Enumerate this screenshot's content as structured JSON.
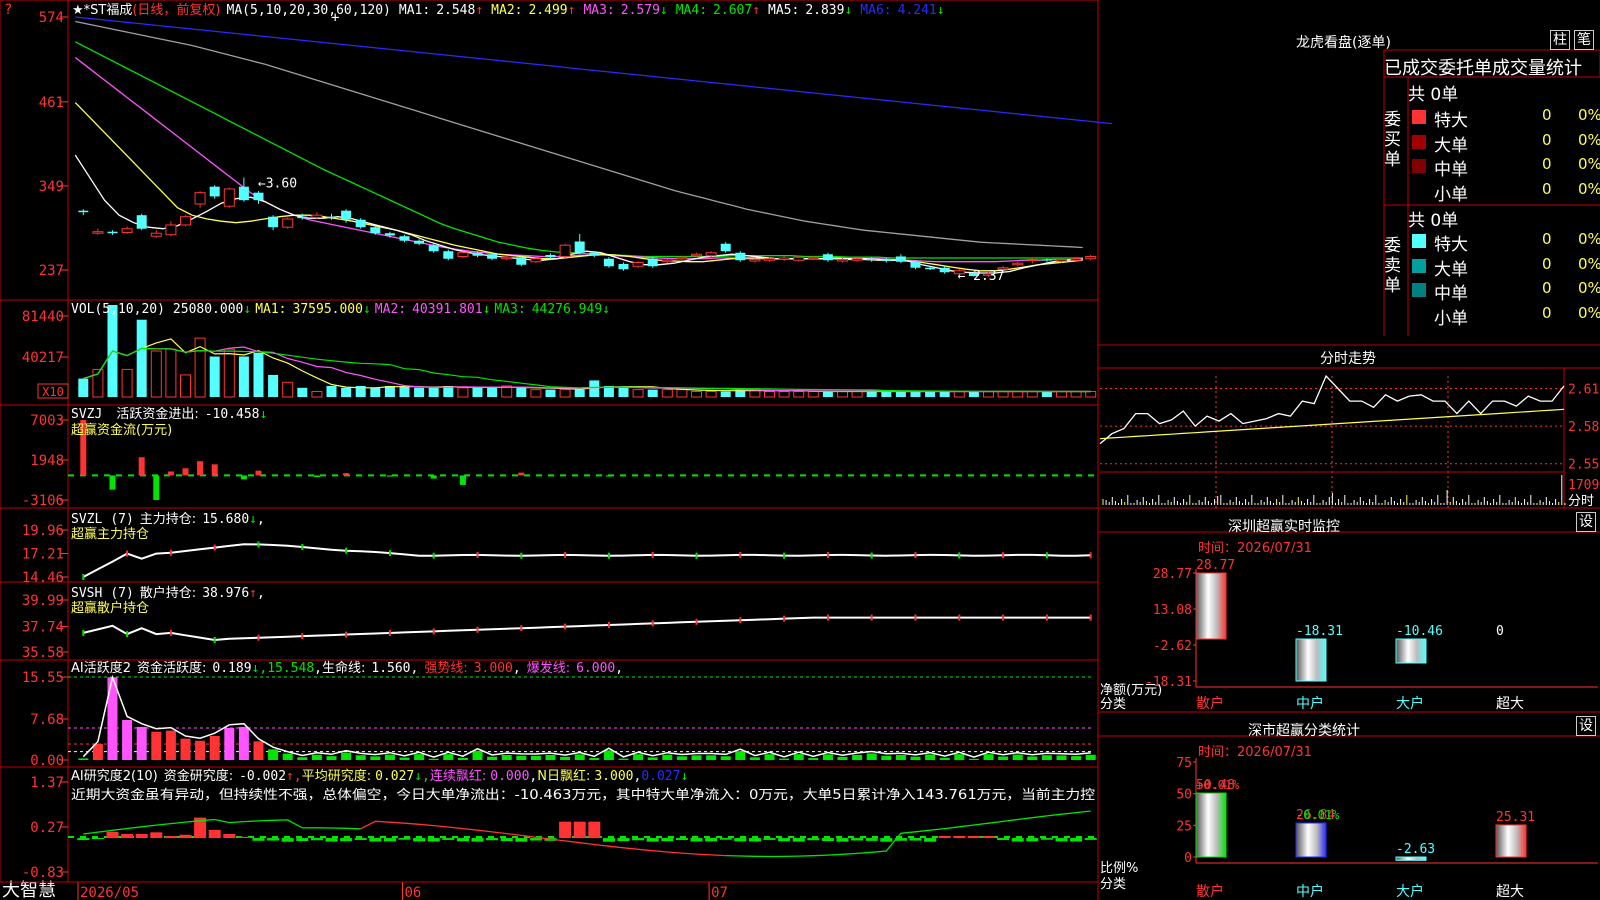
{
  "colors": {
    "up": "#ff3333",
    "down": "#54ffff",
    "frame": "#c00000",
    "yellow": "#ffff54",
    "magenta": "#ff54ff",
    "green": "#00e600",
    "blue": "#2a2aff",
    "white": "#ffffff",
    "grey": "#a0a0a0",
    "orange": "#ffa54a"
  },
  "header": {
    "title": "★*ST福成",
    "mode": "(日线，前复权)",
    "ma_title": "MA(5,10,20,30,60,120)",
    "ma": [
      {
        "label": "MA1:",
        "value": "2.548",
        "arrow": "↑"
      },
      {
        "label": "MA2:",
        "value": "2.499",
        "arrow": "↑"
      },
      {
        "label": "MA3:",
        "value": "2.579",
        "arrow": "↓"
      },
      {
        "label": "MA4:",
        "value": "2.607",
        "arrow": "↑"
      },
      {
        "label": "MA5:",
        "value": "2.839",
        "arrow": "↓"
      },
      {
        "label": "MA6:",
        "value": "4.241",
        "arrow": "↓"
      }
    ]
  },
  "chart_data": {
    "type": "candlestick",
    "candles": [
      [
        3.16,
        3.14,
        3.18,
        3.1
      ],
      [
        2.86,
        2.88,
        2.92,
        2.84
      ],
      [
        2.88,
        2.86,
        2.9,
        2.84
      ],
      [
        2.87,
        2.92,
        2.95,
        2.85
      ],
      [
        3.1,
        2.92,
        3.12,
        2.9
      ],
      [
        2.82,
        2.86,
        2.9,
        2.8
      ],
      [
        2.84,
        2.97,
        3.02,
        2.82
      ],
      [
        2.97,
        3.08,
        3.1,
        2.95
      ],
      [
        3.25,
        3.4,
        3.42,
        3.2
      ],
      [
        3.48,
        3.35,
        3.5,
        3.32
      ],
      [
        3.22,
        3.45,
        3.47,
        3.2
      ],
      [
        3.48,
        3.3,
        3.6,
        3.28
      ],
      [
        3.4,
        3.3,
        3.42,
        3.25
      ],
      [
        3.08,
        2.94,
        3.1,
        2.9
      ],
      [
        2.94,
        3.05,
        3.07,
        2.92
      ],
      [
        3.08,
        3.06,
        3.12,
        3.04
      ],
      [
        3.07,
        3.1,
        3.14,
        3.05
      ],
      [
        3.08,
        3.06,
        3.12,
        3.04
      ],
      [
        3.16,
        3.04,
        3.18,
        3.0
      ],
      [
        3.04,
        2.94,
        3.06,
        2.92
      ],
      [
        2.94,
        2.86,
        2.96,
        2.84
      ],
      [
        2.86,
        2.83,
        2.88,
        2.8
      ],
      [
        2.82,
        2.76,
        2.84,
        2.74
      ],
      [
        2.76,
        2.72,
        2.78,
        2.7
      ],
      [
        2.7,
        2.62,
        2.72,
        2.6
      ],
      [
        2.62,
        2.52,
        2.64,
        2.5
      ],
      [
        2.55,
        2.6,
        2.62,
        2.53
      ],
      [
        2.6,
        2.56,
        2.62,
        2.54
      ],
      [
        2.58,
        2.52,
        2.6,
        2.5
      ],
      [
        2.52,
        2.54,
        2.56,
        2.5
      ],
      [
        2.54,
        2.44,
        2.56,
        2.42
      ],
      [
        2.48,
        2.52,
        2.54,
        2.46
      ],
      [
        2.57,
        2.54,
        2.59,
        2.52
      ],
      [
        2.55,
        2.7,
        2.72,
        2.53
      ],
      [
        2.75,
        2.6,
        2.85,
        2.58
      ],
      [
        2.6,
        2.56,
        2.62,
        2.54
      ],
      [
        2.52,
        2.42,
        2.54,
        2.4
      ],
      [
        2.45,
        2.38,
        2.47,
        2.36
      ],
      [
        2.42,
        2.47,
        2.49,
        2.4
      ],
      [
        2.52,
        2.42,
        2.54,
        2.4
      ],
      [
        2.48,
        2.5,
        2.52,
        2.46
      ],
      [
        2.52,
        2.54,
        2.56,
        2.5
      ],
      [
        2.56,
        2.58,
        2.6,
        2.54
      ],
      [
        2.56,
        2.6,
        2.62,
        2.54
      ],
      [
        2.72,
        2.62,
        2.74,
        2.6
      ],
      [
        2.6,
        2.5,
        2.62,
        2.48
      ],
      [
        2.49,
        2.51,
        2.53,
        2.47
      ],
      [
        2.5,
        2.52,
        2.54,
        2.48
      ],
      [
        2.51,
        2.53,
        2.55,
        2.49
      ],
      [
        2.5,
        2.54,
        2.56,
        2.48
      ],
      [
        2.52,
        2.54,
        2.56,
        2.5
      ],
      [
        2.58,
        2.5,
        2.6,
        2.48
      ],
      [
        2.49,
        2.51,
        2.53,
        2.47
      ],
      [
        2.5,
        2.52,
        2.54,
        2.48
      ],
      [
        2.52,
        2.5,
        2.54,
        2.48
      ],
      [
        2.51,
        2.49,
        2.53,
        2.47
      ],
      [
        2.55,
        2.48,
        2.58,
        2.46
      ],
      [
        2.48,
        2.4,
        2.5,
        2.38
      ],
      [
        2.4,
        2.38,
        2.42,
        2.37
      ],
      [
        2.4,
        2.34,
        2.42,
        2.32
      ],
      [
        2.32,
        2.36,
        2.38,
        2.3
      ],
      [
        2.33,
        2.29,
        2.35,
        2.28
      ],
      [
        2.3,
        2.32,
        2.34,
        2.28
      ],
      [
        2.38,
        2.4,
        2.42,
        2.36
      ],
      [
        2.44,
        2.46,
        2.48,
        2.42
      ],
      [
        2.5,
        2.51,
        2.53,
        2.46
      ],
      [
        2.51,
        2.5,
        2.52,
        2.48
      ],
      [
        2.49,
        2.51,
        2.53,
        2.47
      ],
      [
        2.5,
        2.52,
        2.54,
        2.48
      ],
      [
        2.52,
        2.55,
        2.57,
        2.5
      ]
    ],
    "high_label": "3.60",
    "low_label": "2.37",
    "y_ticks": [
      "574",
      "461",
      "349",
      "237"
    ],
    "x_labels": [
      "2026/05",
      "06",
      "07"
    ],
    "ma_lines": {
      "ma6": [
        5.74,
        5.72,
        5.7,
        5.68,
        5.66,
        5.64,
        5.62,
        5.6,
        5.58,
        5.56,
        5.54,
        5.52,
        5.5,
        5.48,
        5.46,
        5.44,
        5.42,
        5.4,
        5.38,
        5.36,
        5.34,
        5.32,
        5.3,
        5.28,
        5.26,
        5.24,
        5.22,
        5.2,
        5.18,
        5.16,
        5.14,
        5.12,
        5.1,
        5.08,
        5.06,
        5.04,
        5.02,
        5.0,
        4.98,
        4.96,
        4.94,
        4.92,
        4.9,
        4.88,
        4.86,
        4.84,
        4.82,
        4.8,
        4.78,
        4.76,
        4.74,
        4.72,
        4.7,
        4.68,
        4.66,
        4.64,
        4.62,
        4.6,
        4.58,
        4.56,
        4.54,
        4.52,
        4.5,
        4.48,
        4.46,
        4.44,
        4.42,
        4.4,
        4.38,
        4.36,
        4.34,
        4.32
      ],
      "ma5": [
        5.68,
        5.64,
        5.6,
        5.56,
        5.52,
        5.48,
        5.44,
        5.4,
        5.36,
        5.31,
        5.26,
        5.21,
        5.16,
        5.11,
        5.05,
        4.99,
        4.93,
        4.87,
        4.81,
        4.75,
        4.69,
        4.63,
        4.57,
        4.51,
        4.45,
        4.39,
        4.33,
        4.27,
        4.21,
        4.15,
        4.09,
        4.03,
        3.97,
        3.91,
        3.85,
        3.79,
        3.73,
        3.67,
        3.61,
        3.55,
        3.49,
        3.43,
        3.38,
        3.33,
        3.28,
        3.23,
        3.18,
        3.14,
        3.1,
        3.06,
        3.02,
        2.99,
        2.96,
        2.93,
        2.9,
        2.88,
        2.86,
        2.84,
        2.82,
        2.8,
        2.78,
        2.76,
        2.74,
        2.73,
        2.72,
        2.71,
        2.7,
        2.69,
        2.68,
        2.67
      ],
      "ma4": [
        5.41,
        5.31,
        5.21,
        5.11,
        5.01,
        4.91,
        4.81,
        4.71,
        4.61,
        4.51,
        4.41,
        4.31,
        4.21,
        4.11,
        4.01,
        3.91,
        3.81,
        3.71,
        3.62,
        3.53,
        3.44,
        3.35,
        3.26,
        3.17,
        3.08,
        2.99,
        2.92,
        2.86,
        2.8,
        2.74,
        2.7,
        2.66,
        2.63,
        2.61,
        2.6,
        2.59,
        2.58,
        2.57,
        2.56,
        2.55,
        2.55,
        2.55,
        2.55,
        2.55,
        2.55,
        2.56,
        2.56,
        2.56,
        2.56,
        2.56,
        2.55,
        2.55,
        2.55,
        2.54,
        2.54,
        2.54,
        2.53,
        2.53,
        2.53,
        2.53,
        2.53,
        2.53,
        2.53,
        2.53,
        2.53,
        2.53,
        2.53,
        2.53,
        2.53,
        2.53
      ],
      "ma3": [
        5.2,
        5.05,
        4.9,
        4.75,
        4.6,
        4.45,
        4.3,
        4.15,
        4.0,
        3.85,
        3.7,
        3.55,
        3.4,
        3.28,
        3.18,
        3.1,
        3.04,
        3.0,
        2.96,
        2.92,
        2.88,
        2.84,
        2.8,
        2.76,
        2.72,
        2.68,
        2.65,
        2.62,
        2.6,
        2.58,
        2.57,
        2.56,
        2.55,
        2.55,
        2.56,
        2.57,
        2.57,
        2.56,
        2.55,
        2.54,
        2.53,
        2.52,
        2.52,
        2.52,
        2.53,
        2.53,
        2.52,
        2.52,
        2.52,
        2.52,
        2.52,
        2.52,
        2.52,
        2.52,
        2.52,
        2.52,
        2.51,
        2.5,
        2.49,
        2.48,
        2.48,
        2.48,
        2.48,
        2.48,
        2.49,
        2.5,
        2.5,
        2.51,
        2.51,
        2.52
      ],
      "ma2": [
        4.6,
        4.4,
        4.2,
        4.0,
        3.8,
        3.6,
        3.4,
        3.2,
        3.1,
        3.05,
        3.02,
        3.0,
        3.02,
        3.05,
        3.08,
        3.1,
        3.1,
        3.08,
        3.05,
        3.02,
        2.98,
        2.94,
        2.9,
        2.85,
        2.8,
        2.75,
        2.7,
        2.66,
        2.62,
        2.58,
        2.56,
        2.54,
        2.52,
        2.52,
        2.54,
        2.56,
        2.58,
        2.57,
        2.55,
        2.52,
        2.5,
        2.49,
        2.48,
        2.48,
        2.5,
        2.52,
        2.53,
        2.53,
        2.52,
        2.52,
        2.52,
        2.52,
        2.52,
        2.51,
        2.51,
        2.5,
        2.5,
        2.49,
        2.47,
        2.44,
        2.41,
        2.38,
        2.36,
        2.36,
        2.38,
        2.41,
        2.44,
        2.46,
        2.48,
        2.5
      ],
      "ma1": [
        3.9,
        3.6,
        3.3,
        3.1,
        3.0,
        2.94,
        2.92,
        2.96,
        3.05,
        3.15,
        3.26,
        3.32,
        3.34,
        3.28,
        3.18,
        3.1,
        3.06,
        3.06,
        3.08,
        3.05,
        3.0,
        2.95,
        2.9,
        2.84,
        2.76,
        2.7,
        2.64,
        2.6,
        2.57,
        2.55,
        2.53,
        2.51,
        2.5,
        2.52,
        2.58,
        2.62,
        2.6,
        2.54,
        2.48,
        2.44,
        2.44,
        2.46,
        2.5,
        2.54,
        2.56,
        2.58,
        2.56,
        2.54,
        2.52,
        2.52,
        2.52,
        2.52,
        2.53,
        2.52,
        2.52,
        2.51,
        2.5,
        2.49,
        2.44,
        2.4,
        2.36,
        2.34,
        2.33,
        2.33,
        2.35,
        2.4,
        2.44,
        2.48,
        2.5,
        2.52
      ]
    },
    "vol": {
      "title": "VOL(5,10,20)",
      "value": "25080.000",
      "arrow": "↓",
      "ma": [
        {
          "label": "MA1:",
          "value": "37595.000",
          "arrow": "↓"
        },
        {
          "label": "MA2:",
          "value": "40391.801",
          "arrow": "↓"
        },
        {
          "label": "MA3:",
          "value": "44276.949",
          "arrow": "↓"
        }
      ],
      "y_ticks": [
        "81440",
        "40217"
      ],
      "unit": "X10",
      "bars": [
        10,
        15,
        50,
        15,
        42,
        25,
        26,
        12,
        32,
        22,
        26,
        22,
        24,
        12,
        8,
        5,
        3,
        6,
        5,
        6,
        5,
        6,
        6,
        5,
        5,
        6,
        5,
        5,
        5,
        6,
        5,
        4,
        4,
        4,
        4,
        9,
        6,
        5,
        4,
        4,
        4,
        4,
        3,
        3,
        3,
        4,
        4,
        3,
        3,
        3,
        3,
        3,
        3,
        3,
        3,
        3,
        3,
        3,
        3,
        3,
        3,
        3,
        3,
        3,
        3,
        3,
        3,
        3,
        3,
        3
      ]
    },
    "svzj": {
      "title": "SVZJ",
      "label": "活跃资金进出:",
      "value": "-10.458",
      "arrow": "↓",
      "subtitle": "超赢资金流(万元)",
      "y_ticks": [
        "7003",
        "1948",
        "-3106"
      ],
      "bars": [
        7003,
        0,
        -1800,
        0,
        2300,
        -3106,
        500,
        900,
        1800,
        1400,
        0,
        -500,
        600,
        0,
        0,
        0,
        -200,
        0,
        300,
        0,
        0,
        -150,
        0,
        0,
        -400,
        0,
        -1200,
        0,
        0,
        0,
        350,
        0,
        0,
        0,
        0,
        0,
        -150,
        0,
        0,
        0,
        0,
        0,
        0,
        0,
        0,
        0,
        0,
        0,
        0,
        0,
        0,
        0,
        0,
        0,
        0,
        0,
        0,
        0,
        0,
        0,
        0,
        0,
        0,
        0,
        0,
        0,
        0,
        0,
        0,
        0
      ]
    },
    "svzl": {
      "title": "SVZL",
      "period": "(7)",
      "label": "主力持仓:",
      "value": "15.680",
      "arrow": "↓",
      "subtitle": "超赢主力持仓",
      "y_ticks": [
        "19.96",
        "17.21",
        "14.46"
      ]
    },
    "svsh": {
      "title": "SVSH",
      "period": "(7)",
      "label": "散户持仓:",
      "value": "38.976",
      "arrow": "↑",
      "subtitle": "超赢散户持仓",
      "y_ticks": [
        "39.99",
        "37.74",
        "35.58"
      ]
    },
    "ai1": {
      "title": "AI活跃度2",
      "l1": "资金活跃度:",
      "v1": "0.189",
      "v2": "15.548",
      "l3": "生命线:",
      "v3": "1.560",
      "l4": "强势线:",
      "v4": "3.000",
      "l5": "爆发线:",
      "v5": "6.000",
      "y_ticks": [
        "15.55",
        "7.68",
        "0.00"
      ]
    },
    "ai2": {
      "title": "AI研究度2(10)",
      "l1": "资金研究度:",
      "v1": "-0.002",
      "l2": "平均研究度:",
      "v2": "0.027",
      "l3": "连续飘红:",
      "v3": "0.000",
      "l4": "N日飘红:",
      "v4": "3.000",
      "v5": "0.027",
      "y_ticks": [
        "1.37",
        "0.27",
        "-0.83"
      ],
      "comment": "近期大资金虽有异动，但持续性不强，总体偏空，今日大单净流出：-10.463万元，其中特大单净流入：0万元，大单5日累计净入143.761万元，当前主力控"
    }
  },
  "right": {
    "lhb_title": "龙虎看盘(逐单)",
    "btn_zhu": "柱",
    "btn_bi": "笔",
    "order_title": "已成交委托单成交量统计",
    "buy_label": "委买单",
    "sell_label": "委卖单",
    "buy_total": "共 0单",
    "sell_total": "共 0单",
    "sizes": [
      "特大",
      "大单",
      "中单",
      "小单"
    ],
    "buy_rows": [
      {
        "n": "0",
        "p": "0%"
      },
      {
        "n": "0",
        "p": "0%"
      },
      {
        "n": "0",
        "p": "0%"
      },
      {
        "n": "0",
        "p": "0%"
      }
    ],
    "sell_rows": [
      {
        "n": "0",
        "p": "0%"
      },
      {
        "n": "0",
        "p": "0%"
      },
      {
        "n": "0",
        "p": "0%"
      },
      {
        "n": "0",
        "p": "0%"
      }
    ],
    "fs_title": "分时走势",
    "fs_ticks": [
      "2.610",
      "2.580",
      "2.550"
    ],
    "fs_vol": "1709",
    "fs_unit": "分时",
    "sz_title": "深圳超赢实时监控",
    "sz_btn": "设",
    "sz_time": "时间：2026/07/31",
    "sz_ticks": [
      "28.77",
      "13.08",
      "-2.62",
      "-18.31"
    ],
    "sz_bars": [
      {
        "v": 28.77,
        "label": "28.77"
      },
      {
        "v": -18.31,
        "label": "-18.31"
      },
      {
        "v": -10.46,
        "label": "-10.46"
      },
      {
        "v": 0,
        "label": "0"
      }
    ],
    "sz_ylabel": "净额(万元)",
    "sz_xlabel": "分类",
    "cats": [
      "散户",
      "中户",
      "大户",
      "超大"
    ],
    "fl_title": "深市超赢分类统计",
    "fl_btn": "设",
    "fl_time": "时间：2026/07/31",
    "fl_ticks": [
      "75",
      "50",
      "25",
      "0"
    ],
    "fl_bars": [
      {
        "v": 50.48,
        "label": "50.48",
        "ann": "+0.01%"
      },
      {
        "v": 26.84,
        "label": "26.84",
        "ann": "-0.01%"
      },
      {
        "v": -2.63,
        "label": "-2.63",
        "ann": ""
      },
      {
        "v": 25.31,
        "label": "25.31",
        "ann": ""
      }
    ],
    "fl_ylabel": "比例%",
    "fl_xlabel": "分类"
  },
  "footer": {
    "brand": "大智慧"
  }
}
